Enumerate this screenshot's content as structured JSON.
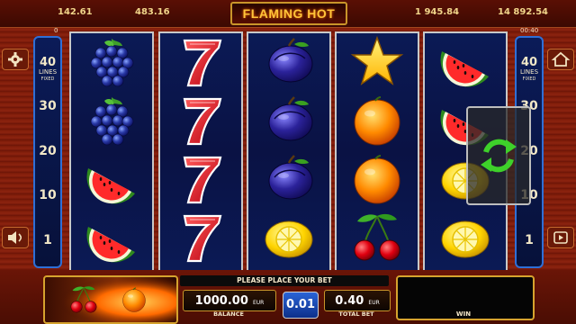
{
  "header": {
    "jackpots": [
      "142.61",
      "483.16",
      "1 945.84",
      "14 892.54"
    ],
    "title": "FLAMING HOT",
    "left_small": "0",
    "right_small": "00:40"
  },
  "lines_panel": {
    "count": "40",
    "label": "LINES",
    "sub": "FIXED",
    "markers": [
      "30",
      "20",
      "10",
      "1"
    ]
  },
  "reels": [
    [
      "grapes",
      "grapes",
      "watermelon",
      "watermelon"
    ],
    [
      "seven",
      "seven",
      "seven",
      "seven"
    ],
    [
      "plum",
      "plum",
      "plum",
      "lemon"
    ],
    [
      "star",
      "orange",
      "orange",
      "cherries"
    ],
    [
      "watermelon",
      "watermelon",
      "lemon",
      "lemon"
    ]
  ],
  "icons": {
    "settings": "gear-icon",
    "sound": "speaker-icon",
    "home": "home-icon",
    "autoplay": "autoplay-icon",
    "reload": "reload-icon"
  },
  "bottom": {
    "message": "PLEASE PLACE YOUR BET",
    "balance_value": "1000.00",
    "balance_currency": "EUR",
    "balance_label": "BALANCE",
    "coin_value": "0.01",
    "total_bet_value": "0.40",
    "total_bet_currency": "EUR",
    "total_bet_label": "TOTAL BET",
    "win_label": "WIN"
  },
  "colors": {
    "reel_bg": "#0a1244",
    "accent_gold": "#c9952a",
    "panel_blue": "#2f6fd6"
  }
}
